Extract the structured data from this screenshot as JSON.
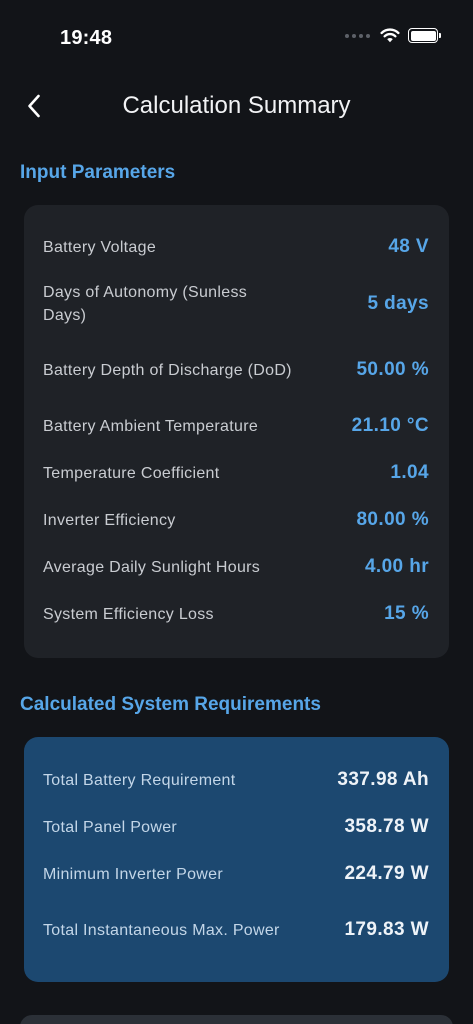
{
  "status_bar": {
    "time": "19:48"
  },
  "nav": {
    "title": "Calculation Summary"
  },
  "input_section": {
    "heading": "Input Parameters",
    "rows": [
      {
        "label": "Battery Voltage",
        "value": "48 V"
      },
      {
        "label": "Days of Autonomy (Sunless Days)",
        "value": "5 days"
      },
      {
        "label": "Battery Depth of Discharge (DoD)",
        "value": "50.00 %"
      },
      {
        "label": "Battery Ambient Temperature",
        "value": "21.10 °C"
      },
      {
        "label": "Temperature Coefficient",
        "value": "1.04"
      },
      {
        "label": "Inverter Efficiency",
        "value": "80.00 %"
      },
      {
        "label": "Average Daily Sunlight Hours",
        "value": "4.00 hr"
      },
      {
        "label": "System Efficiency Loss",
        "value": "15 %"
      }
    ]
  },
  "results_section": {
    "heading": "Calculated System Requirements",
    "rows": [
      {
        "label": "Total Battery Requirement",
        "value": "337.98 Ah"
      },
      {
        "label": "Total Panel Power",
        "value": "358.78 W"
      },
      {
        "label": "Minimum Inverter Power",
        "value": "224.79 W"
      },
      {
        "label": "Total Instantaneous Max. Power",
        "value": "179.83 W"
      }
    ]
  },
  "icons": {
    "back": "chevron-left-icon",
    "wifi": "wifi-icon",
    "battery": "battery-icon",
    "signal": "signal-icon"
  },
  "colors": {
    "background": "#121418",
    "card": "#1f2227",
    "results_card": "#1c4870",
    "accent": "#57a6e8"
  }
}
